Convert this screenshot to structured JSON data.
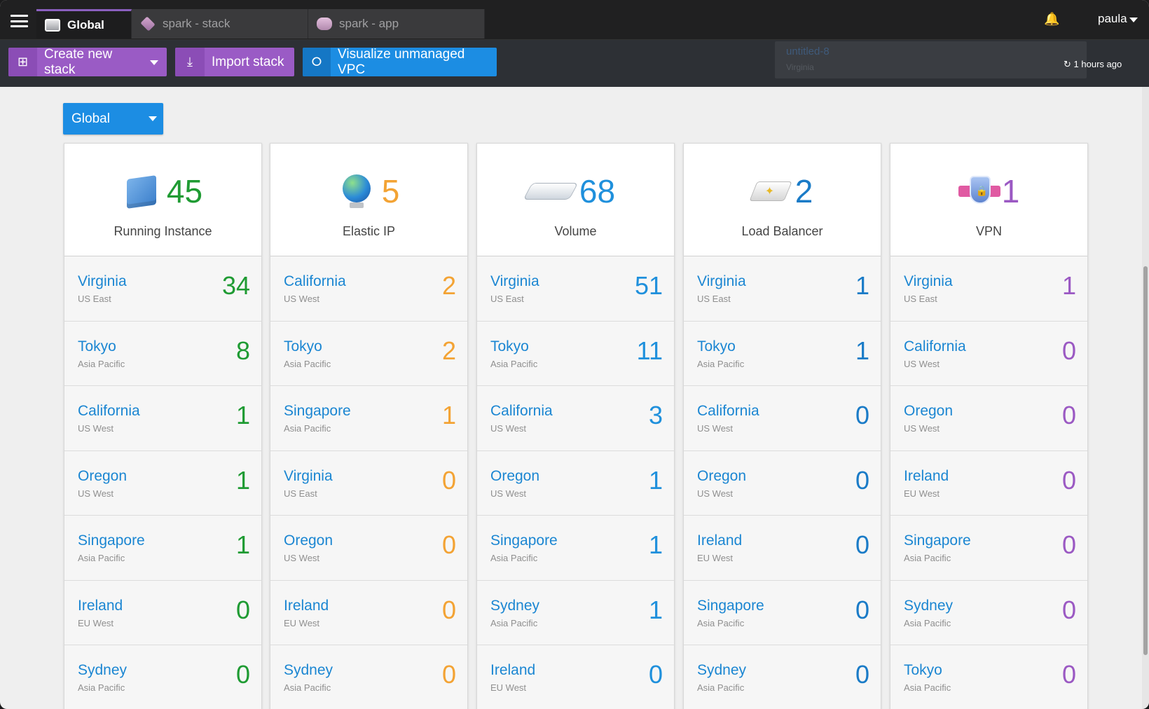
{
  "topbar": {
    "tabs": [
      {
        "label": "Global",
        "icon": "global-tab-icon"
      },
      {
        "label": "spark - stack",
        "icon": "stack-icon"
      },
      {
        "label": "spark - app",
        "icon": "app-icon"
      }
    ],
    "user": "paula",
    "bell_icon": "bell-icon",
    "menu_icon": "hamburger-icon"
  },
  "toolbar": {
    "create_label": "Create new stack",
    "import_label": "Import stack",
    "visualize_label": "Visualize unmanaged VPC",
    "recent": {
      "name": "untitled-8",
      "region": "Virginia",
      "time": "1 hours ago"
    }
  },
  "region_select": {
    "selected": "Global"
  },
  "colors": {
    "accent_purple": "#9a5bc5",
    "accent_blue": "#1c8de3",
    "instance_green": "#1f9b33",
    "eip_orange": "#f3a334",
    "volume_blue": "#1f90dc",
    "lb_blue": "#1a7bc7",
    "vpn_purple": "#9b59c3"
  },
  "cards": [
    {
      "title": "Running Instance",
      "total": "45",
      "icon": "instance-cube-icon",
      "rows": [
        {
          "name": "Virginia",
          "sub": "US East",
          "count": "34"
        },
        {
          "name": "Tokyo",
          "sub": "Asia Pacific",
          "count": "8"
        },
        {
          "name": "California",
          "sub": "US West",
          "count": "1"
        },
        {
          "name": "Oregon",
          "sub": "US West",
          "count": "1"
        },
        {
          "name": "Singapore",
          "sub": "Asia Pacific",
          "count": "1"
        },
        {
          "name": "Ireland",
          "sub": "EU West",
          "count": "0"
        },
        {
          "name": "Sydney",
          "sub": "Asia Pacific",
          "count": "0"
        }
      ]
    },
    {
      "title": "Elastic IP",
      "total": "5",
      "icon": "globe-icon",
      "rows": [
        {
          "name": "California",
          "sub": "US West",
          "count": "2"
        },
        {
          "name": "Tokyo",
          "sub": "Asia Pacific",
          "count": "2"
        },
        {
          "name": "Singapore",
          "sub": "Asia Pacific",
          "count": "1"
        },
        {
          "name": "Virginia",
          "sub": "US East",
          "count": "0"
        },
        {
          "name": "Oregon",
          "sub": "US West",
          "count": "0"
        },
        {
          "name": "Ireland",
          "sub": "EU West",
          "count": "0"
        },
        {
          "name": "Sydney",
          "sub": "Asia Pacific",
          "count": "0"
        }
      ]
    },
    {
      "title": "Volume",
      "total": "68",
      "icon": "volume-disk-icon",
      "rows": [
        {
          "name": "Virginia",
          "sub": "US East",
          "count": "51"
        },
        {
          "name": "Tokyo",
          "sub": "Asia Pacific",
          "count": "11"
        },
        {
          "name": "California",
          "sub": "US West",
          "count": "3"
        },
        {
          "name": "Oregon",
          "sub": "US West",
          "count": "1"
        },
        {
          "name": "Singapore",
          "sub": "Asia Pacific",
          "count": "1"
        },
        {
          "name": "Sydney",
          "sub": "Asia Pacific",
          "count": "1"
        },
        {
          "name": "Ireland",
          "sub": "EU West",
          "count": "0"
        }
      ]
    },
    {
      "title": "Load Balancer",
      "total": "2",
      "icon": "load-balancer-icon",
      "rows": [
        {
          "name": "Virginia",
          "sub": "US East",
          "count": "1"
        },
        {
          "name": "Tokyo",
          "sub": "Asia Pacific",
          "count": "1"
        },
        {
          "name": "California",
          "sub": "US West",
          "count": "0"
        },
        {
          "name": "Oregon",
          "sub": "US West",
          "count": "0"
        },
        {
          "name": "Ireland",
          "sub": "EU West",
          "count": "0"
        },
        {
          "name": "Singapore",
          "sub": "Asia Pacific",
          "count": "0"
        },
        {
          "name": "Sydney",
          "sub": "Asia Pacific",
          "count": "0"
        }
      ]
    },
    {
      "title": "VPN",
      "total": "1",
      "icon": "vpn-shield-icon",
      "rows": [
        {
          "name": "Virginia",
          "sub": "US East",
          "count": "1"
        },
        {
          "name": "California",
          "sub": "US West",
          "count": "0"
        },
        {
          "name": "Oregon",
          "sub": "US West",
          "count": "0"
        },
        {
          "name": "Ireland",
          "sub": "EU West",
          "count": "0"
        },
        {
          "name": "Singapore",
          "sub": "Asia Pacific",
          "count": "0"
        },
        {
          "name": "Sydney",
          "sub": "Asia Pacific",
          "count": "0"
        },
        {
          "name": "Tokyo",
          "sub": "Asia Pacific",
          "count": "0"
        }
      ]
    }
  ]
}
